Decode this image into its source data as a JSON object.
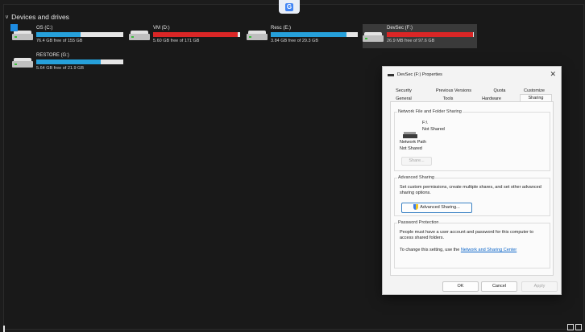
{
  "section": {
    "title": "Devices and drives"
  },
  "app_badge_icon": "google-translate-icon",
  "drives": [
    {
      "name": "OS (C:)",
      "free": "76.4 GB free of 155 GB",
      "used_fraction": 0.51,
      "bar_color": "#26a0da",
      "icon": "system-drive-icon"
    },
    {
      "name": "VM (D:)",
      "free": "5.60 GB free of 171 GB",
      "used_fraction": 0.97,
      "bar_color": "#da2626",
      "icon": "hard-drive-icon"
    },
    {
      "name": "Resc (E:)",
      "free": "3.84 GB free of 29.3 GB",
      "used_fraction": 0.87,
      "bar_color": "#26a0da",
      "icon": "hard-drive-icon"
    },
    {
      "name": "DevSec (F:)",
      "free": "26.9 MB free of 97.6 GB",
      "used_fraction": 0.99,
      "bar_color": "#da2626",
      "icon": "hard-drive-icon"
    },
    {
      "name": "RESTORE (G:)",
      "free": "5.64 GB free of 21.9 GB",
      "used_fraction": 0.74,
      "bar_color": "#26a0da",
      "icon": "hard-drive-icon"
    }
  ],
  "dialog": {
    "title": "DevSec (F:) Properties",
    "tabs_row1": [
      "Security",
      "Previous Versions",
      "Quota",
      "Customize"
    ],
    "tabs_row2": [
      "General",
      "Tools",
      "Hardware",
      "Sharing"
    ],
    "network_sharing": {
      "label": "Network File and Folder Sharing",
      "drive": "F:\\",
      "status": "Not Shared",
      "path_label": "Network Path",
      "path_value": "Not Shared",
      "share_button": "Share..."
    },
    "advanced_sharing": {
      "label": "Advanced Sharing",
      "description": "Set custom permissions, create multiple shares, and set other advanced sharing options.",
      "button": "Advanced Sharing..."
    },
    "password_protection": {
      "label": "Password Protection",
      "description": "People must have a user account and password for this computer to access shared folders.",
      "change_prefix": "To change this setting, use the ",
      "link": "Network and Sharing Center"
    },
    "buttons": {
      "ok": "OK",
      "cancel": "Cancel",
      "apply": "Apply"
    }
  }
}
